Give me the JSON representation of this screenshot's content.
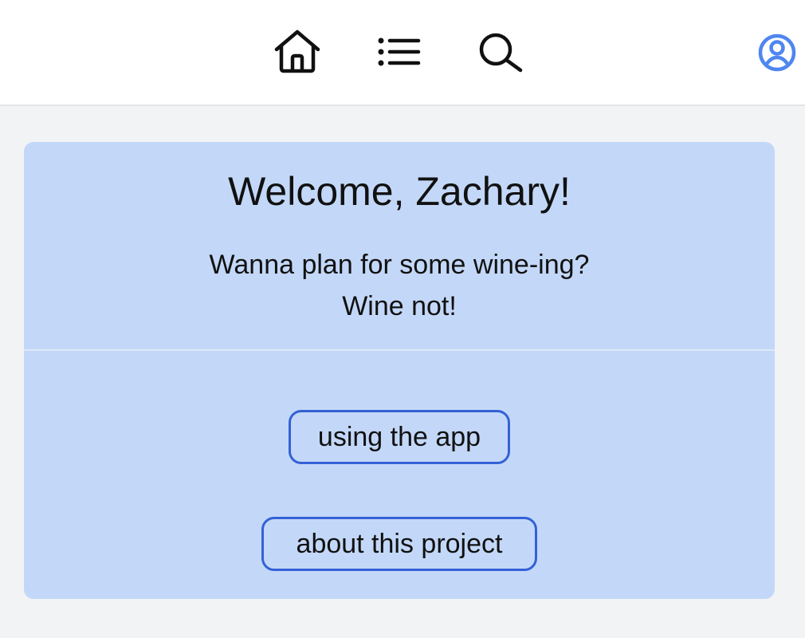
{
  "nav": {
    "icons": [
      "home-icon",
      "list-icon",
      "search-icon",
      "user-icon"
    ],
    "icon_color": "#111111",
    "profile_color": "#4f86f0"
  },
  "welcome": {
    "title": "Welcome, Zachary!",
    "line1": "Wanna plan for some wine-ing?",
    "line2": "Wine not!"
  },
  "buttons": {
    "using_app": "using the app",
    "about_project": "about this project",
    "border_color": "#3461d6"
  },
  "colors": {
    "page_bg": "#f2f3f5",
    "card_bg": "#c3d8f8"
  }
}
